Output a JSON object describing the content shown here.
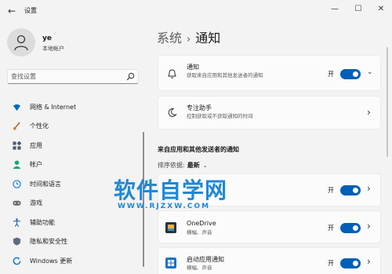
{
  "window": {
    "title": "设置",
    "back_glyph": "←",
    "min_glyph": "—",
    "max_glyph": "☐",
    "close_glyph": "✕"
  },
  "profile": {
    "name": "ye",
    "account_type": "本地帐户"
  },
  "search": {
    "placeholder": "查找设置"
  },
  "nav": {
    "items": [
      {
        "label": "网络 & Internet",
        "icon": "wifi-icon",
        "color": "#0067c0"
      },
      {
        "label": "个性化",
        "icon": "brush-icon",
        "color": "#e07b2c"
      },
      {
        "label": "应用",
        "icon": "apps-icon",
        "color": "#4a5a6b"
      },
      {
        "label": "帐户",
        "icon": "person-icon",
        "color": "#1aa37a"
      },
      {
        "label": "时间和语言",
        "icon": "globe-clock-icon",
        "color": "#2b88d8"
      },
      {
        "label": "游戏",
        "icon": "gamepad-icon",
        "color": "#6b6b6b"
      },
      {
        "label": "辅助功能",
        "icon": "accessibility-icon",
        "color": "#2b6cb0"
      },
      {
        "label": "隐私和安全性",
        "icon": "shield-icon",
        "color": "#5f6b7a"
      },
      {
        "label": "Windows 更新",
        "icon": "update-icon",
        "color": "#0078d4"
      }
    ]
  },
  "breadcrumb": {
    "parent": "系统",
    "separator": "›",
    "current": "通知"
  },
  "cards": {
    "notifications": {
      "title": "通知",
      "desc": "获取来自应用和其他发送者的通知",
      "toggle_label": "开",
      "expand_glyph": "⌄"
    },
    "focus": {
      "title": "专注助手",
      "desc": "控制获取或不获取通知的时间",
      "chevron": "›"
    }
  },
  "apps_section": {
    "title": "来自应用和其他发送者的通知",
    "sort_label": "排序依据:",
    "sort_value": "最新",
    "sort_glyph": "⌄",
    "apps": [
      {
        "name": "",
        "desc": "",
        "toggle_label": "开",
        "chevron": "›"
      },
      {
        "name": "OneDrive",
        "desc": "横幅、声音",
        "toggle_label": "开",
        "chevron": "›",
        "icon": "onedrive-icon"
      },
      {
        "name": "启动应用通知",
        "desc": "横幅、声音",
        "toggle_label": "开",
        "chevron": "›",
        "icon": "startup-apps-icon"
      }
    ]
  },
  "watermark": {
    "main": "软件自学网",
    "sub": "WWW.RJZXW.COM"
  },
  "colors": {
    "accent": "#005fb8",
    "watermark": "#1f88d6"
  }
}
